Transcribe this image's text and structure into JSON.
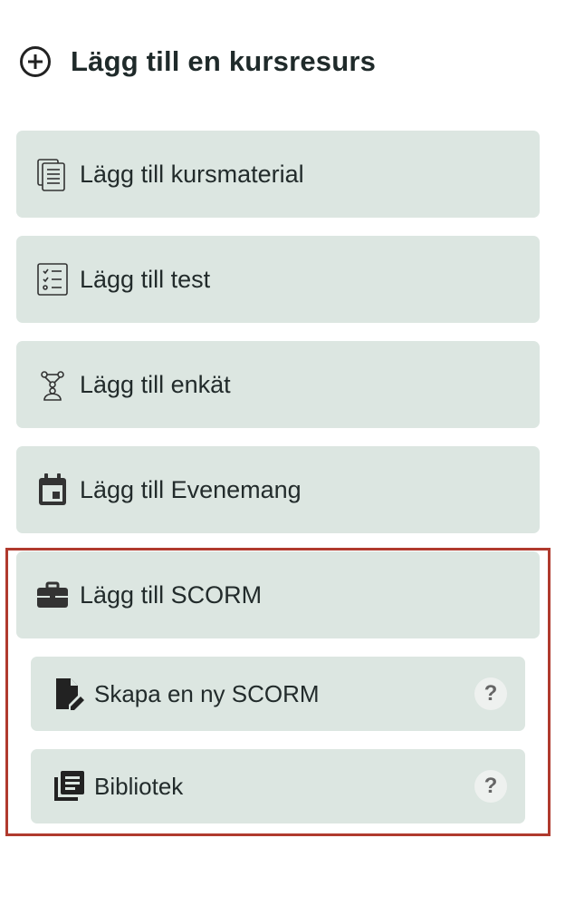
{
  "header": {
    "title": "Lägg till en kursresurs",
    "icon": "plus-circle-icon"
  },
  "items": [
    {
      "label": "Lägg till kursmaterial",
      "icon": "documents-icon"
    },
    {
      "label": "Lägg till test",
      "icon": "checklist-icon"
    },
    {
      "label": "Lägg till enkät",
      "icon": "survey-icon"
    },
    {
      "label": "Lägg till Evenemang",
      "icon": "calendar-icon"
    },
    {
      "label": "Lägg till SCORM",
      "icon": "briefcase-icon"
    }
  ],
  "scorm_options": [
    {
      "label": "Skapa en ny SCORM",
      "icon": "edit-document-icon",
      "help": "?"
    },
    {
      "label": "Bibliotek",
      "icon": "library-icon",
      "help": "?"
    }
  ],
  "colors": {
    "card_bg": "#dce6e1",
    "highlight_border": "#b03a2e"
  }
}
